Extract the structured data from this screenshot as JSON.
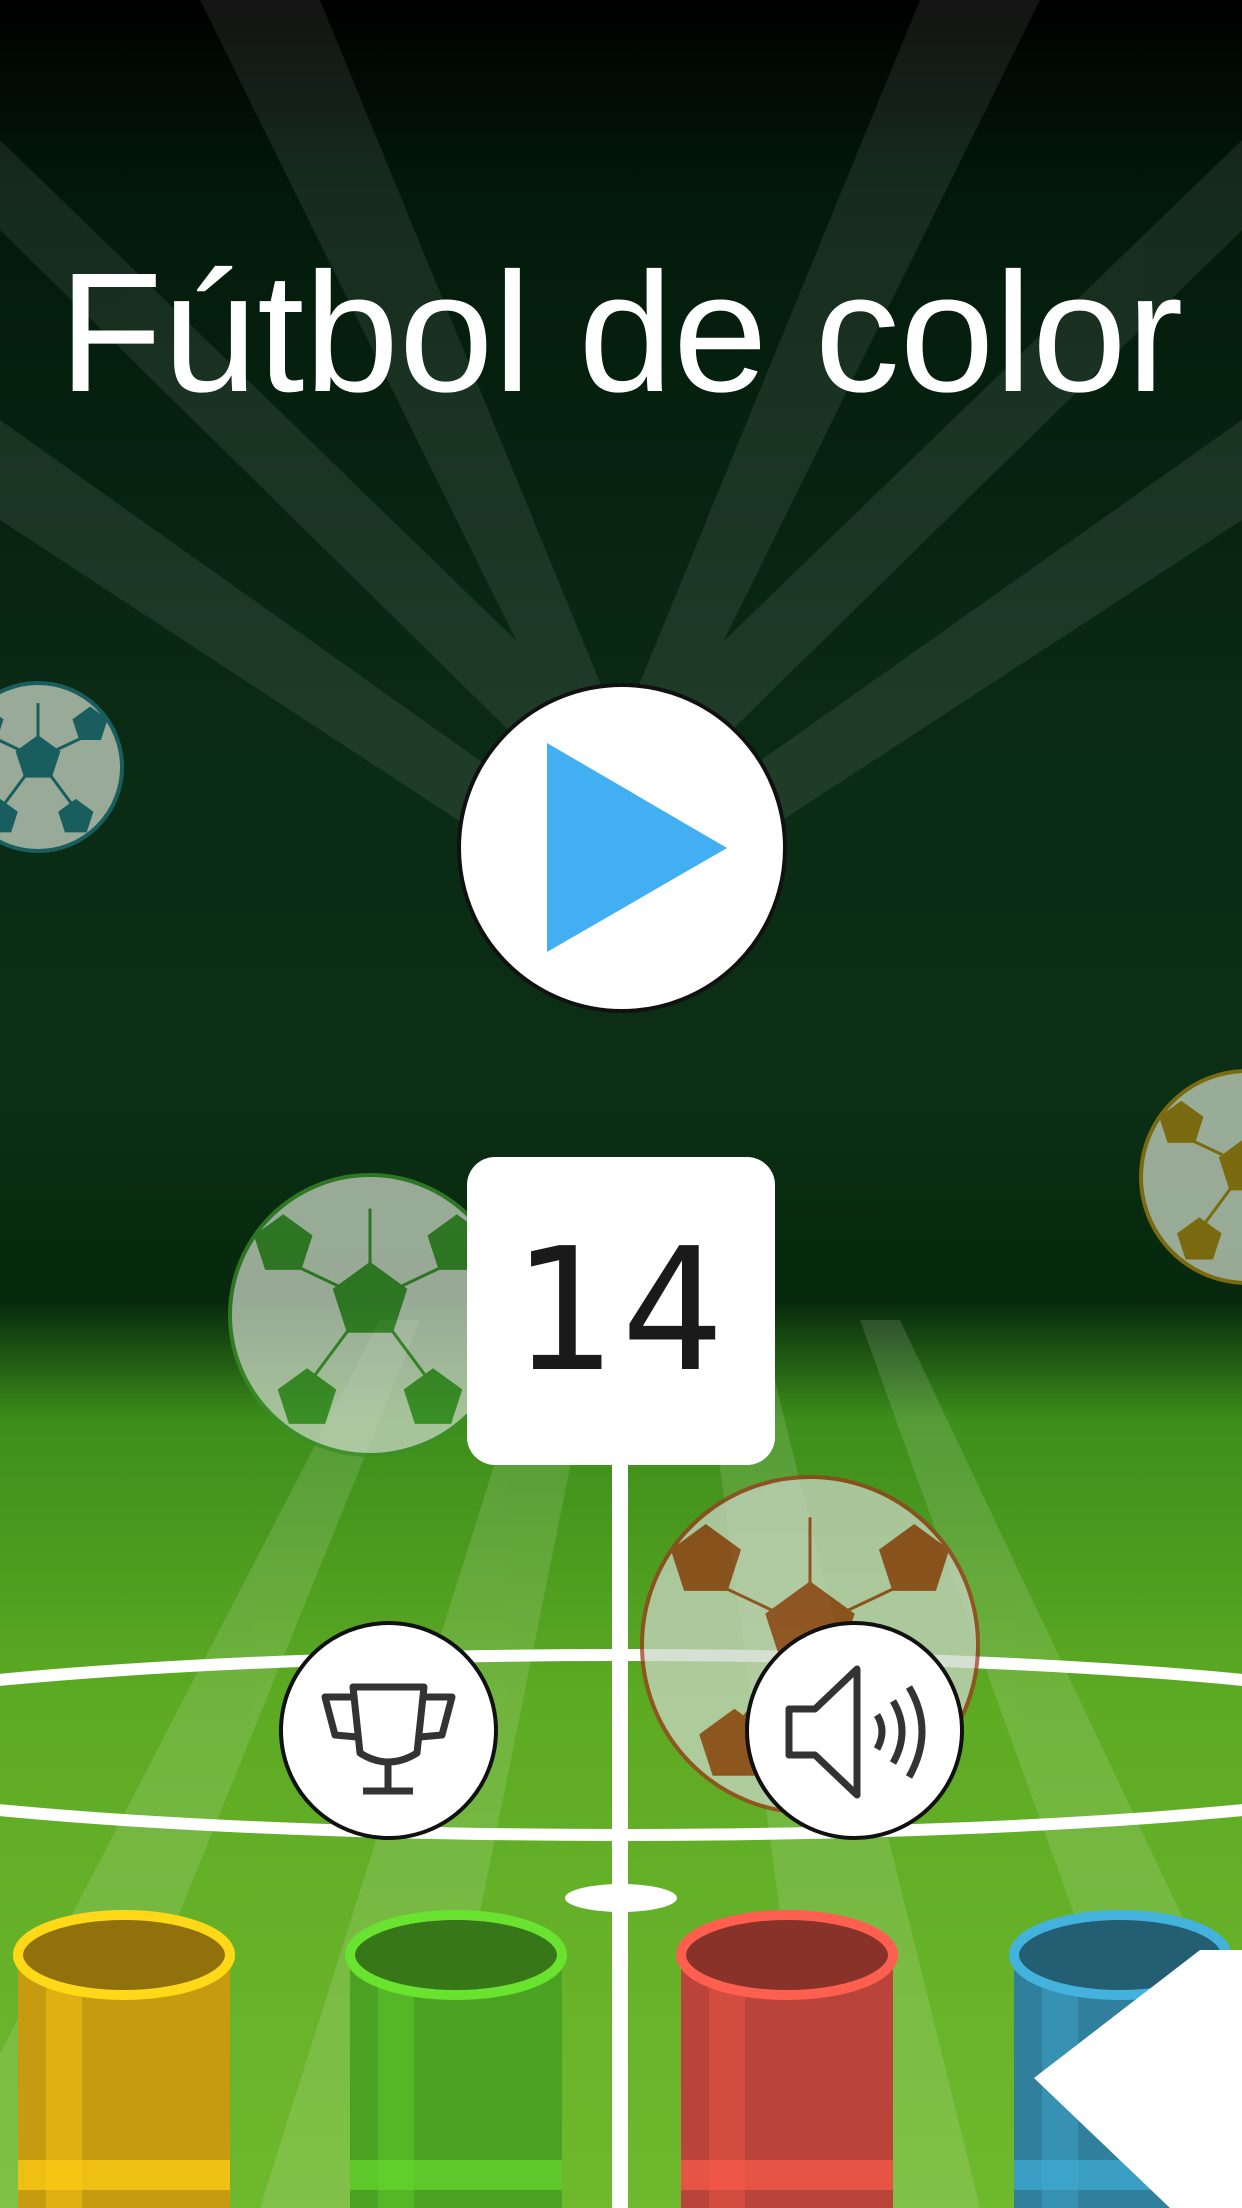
{
  "game": {
    "title": "Fútbol de color",
    "best_score": "14",
    "colors": {
      "play_triangle": "#42aff2",
      "field_green": "#5daa23",
      "line_white": "#ffffff"
    }
  },
  "buttons": {
    "play": {
      "icon": "play-icon"
    },
    "leaderboard": {
      "icon": "trophy-icon"
    },
    "sound": {
      "icon": "speaker-icon"
    },
    "next": {
      "icon": "arrow-left-icon"
    }
  },
  "balls": [
    {
      "color": "#1e6f78"
    },
    {
      "color": "#3a8f2a"
    },
    {
      "color": "#a07f10"
    },
    {
      "color": "#9c3a1c"
    }
  ],
  "buckets": [
    {
      "color": "#f2bd14"
    },
    {
      "color": "#5cc52a"
    },
    {
      "color": "#e35345"
    },
    {
      "color": "#3a9cc0"
    }
  ]
}
